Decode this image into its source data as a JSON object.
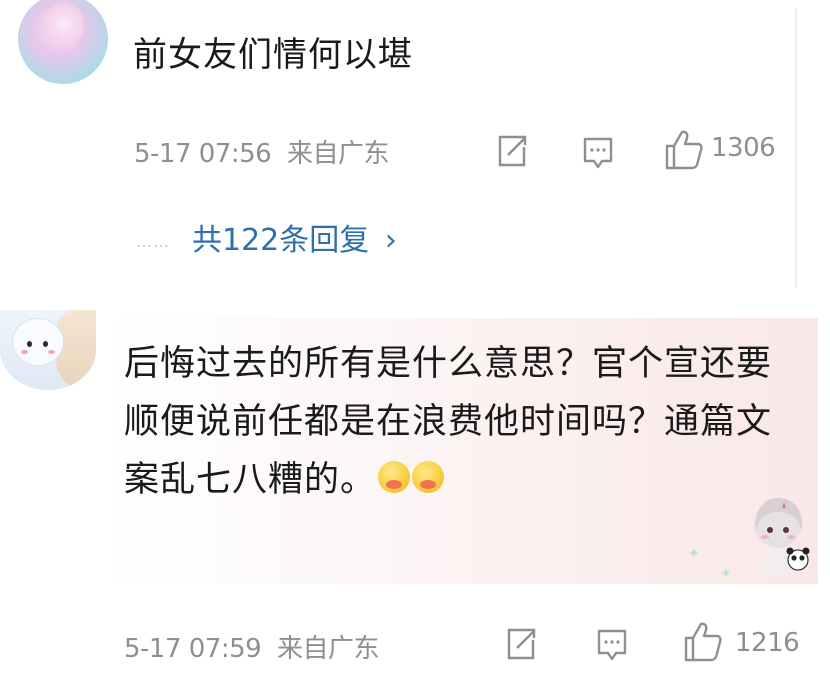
{
  "comments": [
    {
      "text": "前女友们情何以堪",
      "time": "5-17 07:56",
      "location": "来自广东",
      "likes": "1306",
      "replies_label": "共122条回复",
      "replies_chevron": "›",
      "replies_dots": "……"
    },
    {
      "text": "后悔过去的所有是什么意思？官个宣还要顺便说前任都是在浪费他时间吗？通篇文案乱七八糟的。",
      "time": "5-17 07:59",
      "location": "来自广东",
      "likes": "1216"
    }
  ],
  "icons": {
    "share": "share-icon",
    "comment": "comment-icon",
    "like": "thumbs-up-icon"
  },
  "colors": {
    "text": "#1a1a1a",
    "meta": "#8f8f8f",
    "link": "#2e6fb0",
    "bubble": "#fae8e8"
  }
}
